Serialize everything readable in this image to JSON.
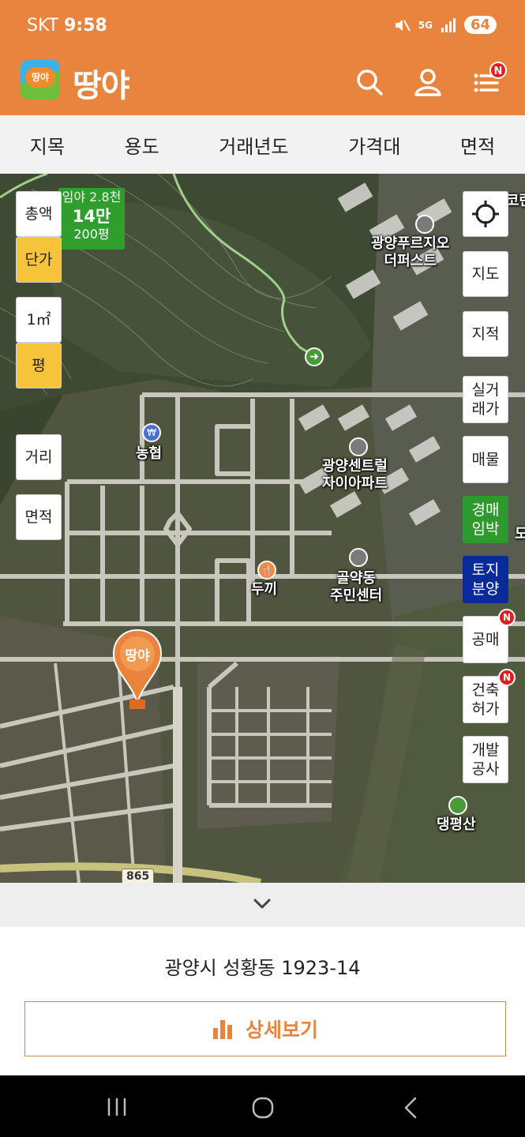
{
  "status": {
    "carrier": "SKT",
    "time": "9:58",
    "network": "5G",
    "battery": "64"
  },
  "header": {
    "logo_text": "땅야",
    "title": "땅야",
    "notification_badge": "N"
  },
  "filters": [
    "지목",
    "용도",
    "거래년도",
    "가격대",
    "면적"
  ],
  "map": {
    "left_buttons": {
      "total": "총액",
      "unit_price": "단가",
      "sqm": "1㎡",
      "pyeong": "평",
      "distance": "거리",
      "area": "면적"
    },
    "price_tag": {
      "line1": "임야 2.8천",
      "line2": "14만",
      "line3": "200평"
    },
    "right_buttons": {
      "map": "지도",
      "cadastral": "지적",
      "real_trade": "실거\n래가",
      "listing": "매물",
      "auction": "경매\n임박",
      "land_sale": "토지\n분양",
      "public_sale": "공매",
      "building_permit": "건축\n허가",
      "development": "개발\n공사"
    },
    "new_badge": "N",
    "labels": {
      "apt1": "광양푸르지오\n더퍼스트",
      "nh": "농협",
      "apt2": "광양센트럴\n자이아파트",
      "dugi": "두끼",
      "center": "골약동\n주민센터",
      "mountain": "댕평산",
      "edge1": "코란",
      "edge2": "도"
    },
    "marker": "땅야",
    "road_number": "865"
  },
  "sheet": {
    "address": "광양시 성황동 1923-14",
    "detail_button": "상세보기"
  },
  "colors": {
    "brand": "#e8843e",
    "yellow": "#f5c43a",
    "green": "#2e9a2e",
    "navy": "#0a2a9a"
  }
}
